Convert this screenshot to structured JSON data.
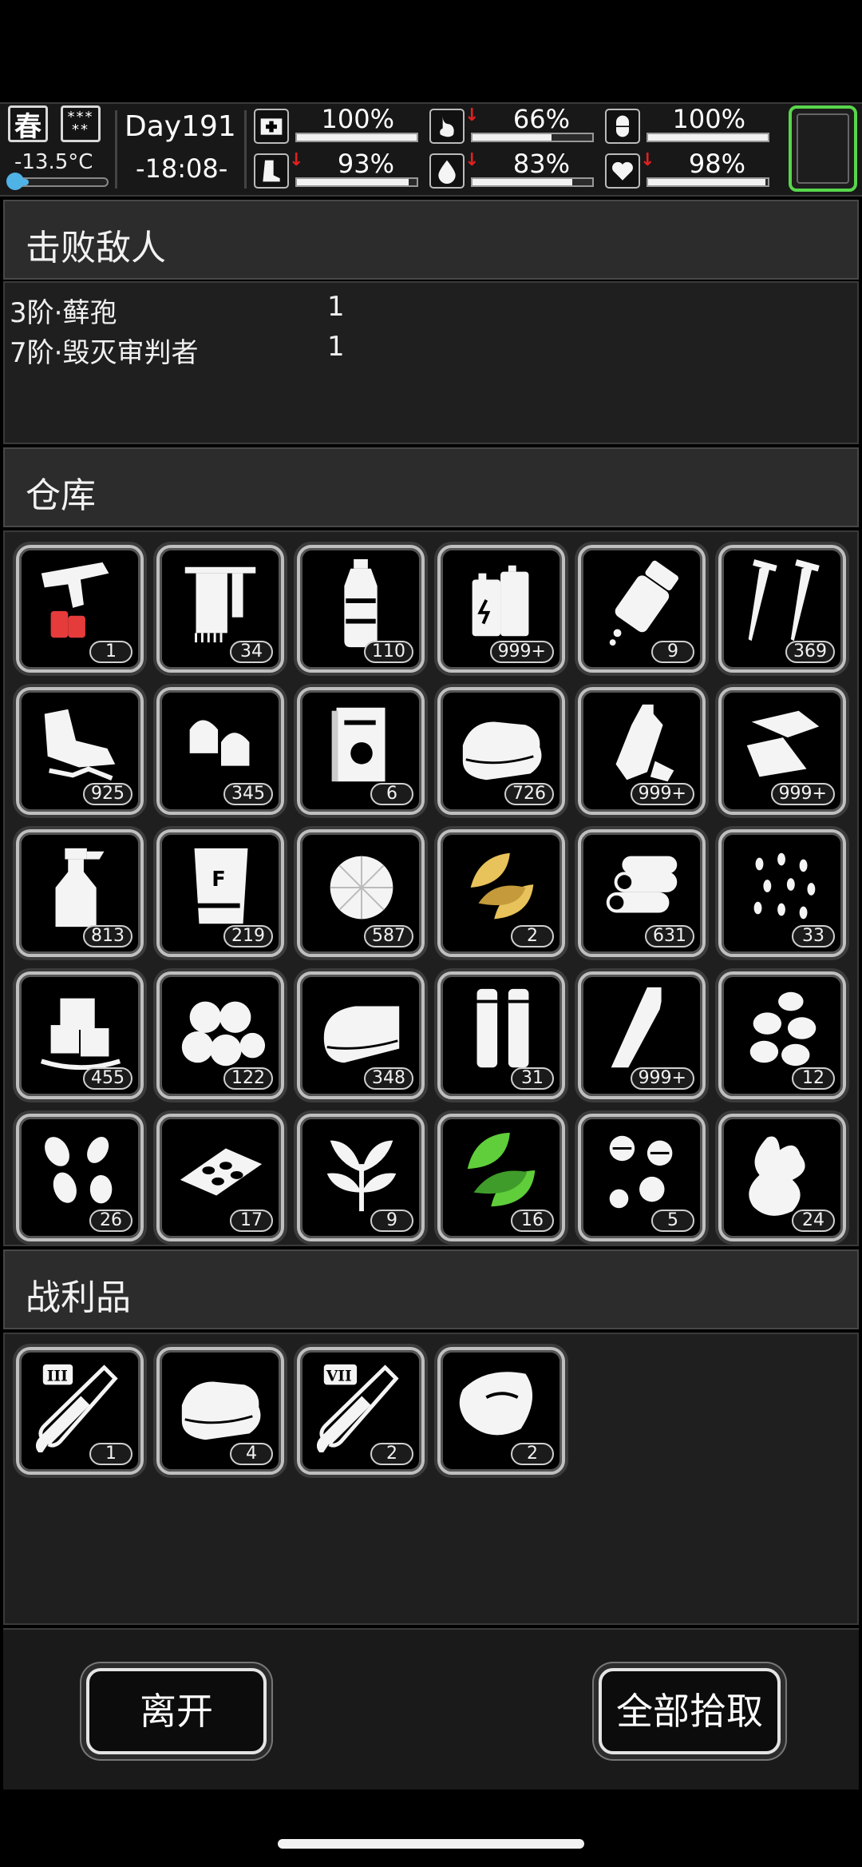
{
  "status": {
    "season": "春",
    "weather": "***\n**",
    "temperature": "-13.5°C",
    "temperature_fill": 0.2,
    "day": "Day191",
    "time": "-18:08-",
    "stats": [
      {
        "icon": "medkit-icon",
        "value": "100%",
        "level": 1.0,
        "down": false
      },
      {
        "icon": "stomach-icon",
        "value": "66%",
        "level": 0.66,
        "down": true
      },
      {
        "icon": "pill-icon",
        "value": "100%",
        "level": 1.0,
        "down": false
      },
      {
        "icon": "foot-icon",
        "value": "93%",
        "level": 0.93,
        "down": true
      },
      {
        "icon": "water-drop-icon",
        "value": "83%",
        "level": 0.83,
        "down": true
      },
      {
        "icon": "heart-icon",
        "value": "98%",
        "level": 0.98,
        "down": true
      }
    ],
    "accent_color": "#58d64c"
  },
  "defeated": {
    "title": "击败敌人",
    "enemies": [
      {
        "name": "3阶·藓孢",
        "count": "1"
      },
      {
        "name": "7阶·毁灭审判者",
        "count": "1"
      }
    ]
  },
  "warehouse": {
    "title": "仓库",
    "items": [
      {
        "icon": "flare-gun-icon",
        "count": "1"
      },
      {
        "icon": "towel-rack-icon",
        "count": "34"
      },
      {
        "icon": "water-bottle-icon",
        "count": "110"
      },
      {
        "icon": "battery-icon",
        "count": "999+"
      },
      {
        "icon": "pill-bottle-icon",
        "count": "9"
      },
      {
        "icon": "nails-icon",
        "count": "369"
      },
      {
        "icon": "rag-scraps-icon",
        "count": "925"
      },
      {
        "icon": "bullet-icon",
        "count": "345"
      },
      {
        "icon": "book-icon",
        "count": "6"
      },
      {
        "icon": "cloth-pile-icon",
        "count": "726"
      },
      {
        "icon": "crushed-bottle-icon",
        "count": "999+"
      },
      {
        "icon": "metal-scrap-icon",
        "count": "999+"
      },
      {
        "icon": "spray-bottle-icon",
        "count": "813"
      },
      {
        "icon": "fertilizer-bag-icon",
        "count": "219"
      },
      {
        "icon": "cotton-icon",
        "count": "587"
      },
      {
        "icon": "yellow-leaf-icon",
        "count": "2"
      },
      {
        "icon": "logs-icon",
        "count": "631"
      },
      {
        "icon": "seeds-icon",
        "count": "33"
      },
      {
        "icon": "ice-icon",
        "count": "455"
      },
      {
        "icon": "potatoes-icon",
        "count": "122"
      },
      {
        "icon": "folded-cloth-icon",
        "count": "348"
      },
      {
        "icon": "cylinders-icon",
        "count": "31"
      },
      {
        "icon": "glass-bottle-icon",
        "count": "999+"
      },
      {
        "icon": "beans-icon",
        "count": "12"
      },
      {
        "icon": "peanuts-icon",
        "count": "26"
      },
      {
        "icon": "chips-tray-icon",
        "count": "17"
      },
      {
        "icon": "herb-plant-icon",
        "count": "9"
      },
      {
        "icon": "green-leaf-icon",
        "count": "16"
      },
      {
        "icon": "tablets-icon",
        "count": "5"
      },
      {
        "icon": "ginger-root-icon",
        "count": "24"
      }
    ]
  },
  "loot": {
    "title": "战利品",
    "items": [
      {
        "icon": "test-tube-iii-icon",
        "count": "1",
        "label": "III"
      },
      {
        "icon": "cloth-pile-icon",
        "count": "4"
      },
      {
        "icon": "test-tube-vii-icon",
        "count": "2",
        "label": "VII"
      },
      {
        "icon": "meat-chunk-icon",
        "count": "2"
      }
    ]
  },
  "buttons": {
    "leave": "离开",
    "take_all": "全部拾取"
  }
}
